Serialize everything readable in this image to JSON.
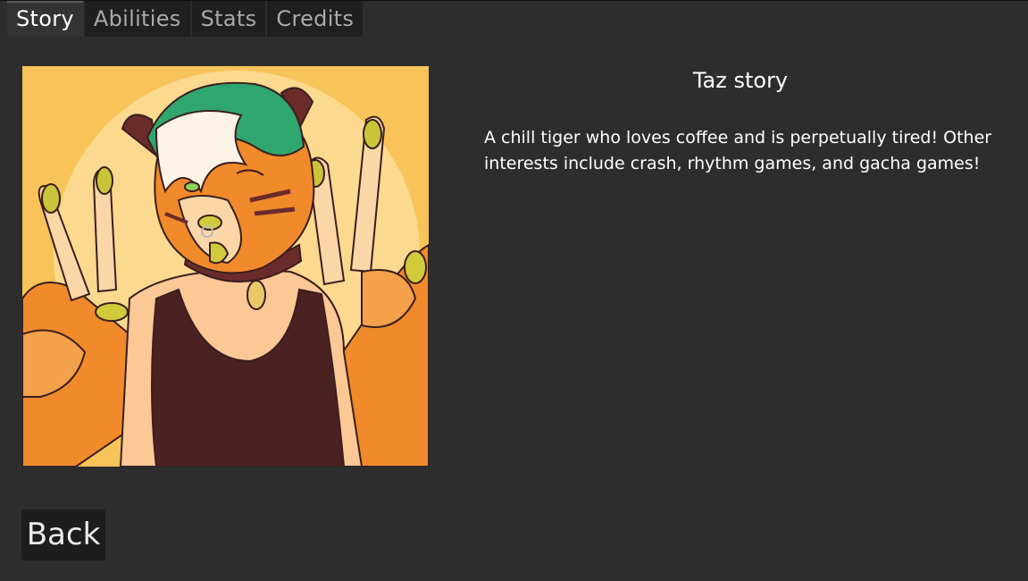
{
  "tabs": [
    {
      "label": "Story",
      "active": true
    },
    {
      "label": "Abilities",
      "active": false
    },
    {
      "label": "Stats",
      "active": false
    },
    {
      "label": "Credits",
      "active": false
    }
  ],
  "story": {
    "title": "Taz story",
    "text": "A chill tiger who loves coffee and is perpetually tired! Other interests include crash, rhythm games, and gacha games!"
  },
  "portrait": {
    "icon": "tiger-character-portrait",
    "background_color": "#f8c45a"
  },
  "back_button": {
    "label": "Back"
  },
  "colors": {
    "background": "#2d2d2d",
    "tab_bg": "#1f1f1f",
    "tab_active_bg": "#333333",
    "text": "#ffffff"
  }
}
